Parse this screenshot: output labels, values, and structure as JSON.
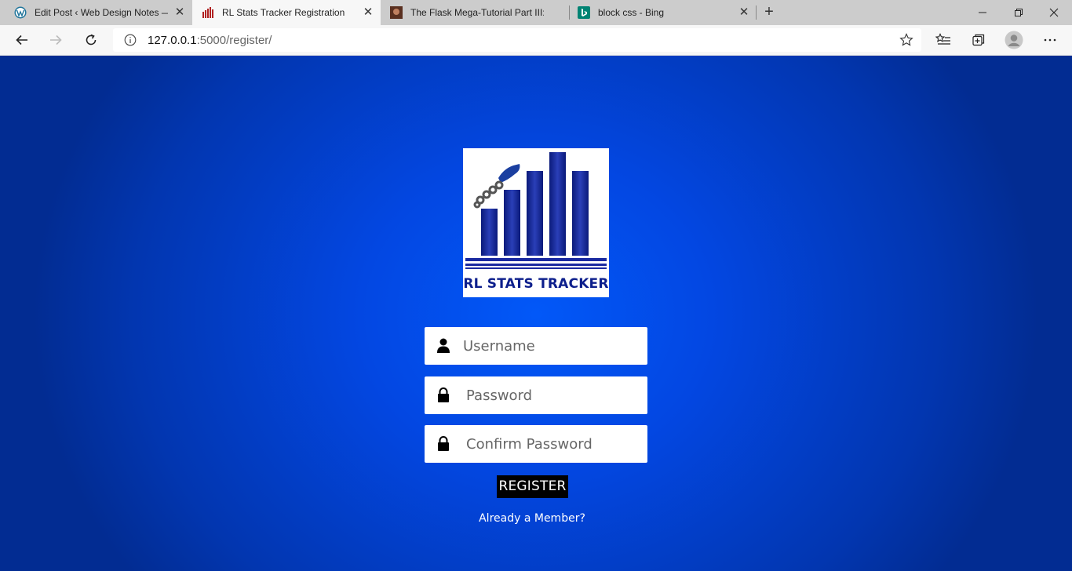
{
  "browser": {
    "tabs": [
      {
        "title": "Edit Post ‹ Web Design Notes —",
        "favicon": "wordpress-icon"
      },
      {
        "title": "RL Stats Tracker Registration",
        "favicon": "rl-stats-icon",
        "active": true
      },
      {
        "title": "The Flask Mega-Tutorial Part III: W",
        "favicon": "flask-author-icon"
      },
      {
        "title": "block css - Bing",
        "favicon": "bing-icon"
      }
    ],
    "new_tab_label": "+",
    "address": {
      "host": "127.0.0.1",
      "path": ":5000/register/"
    }
  },
  "page": {
    "logo": {
      "text": "RL STATS TRACKER",
      "icon": "bar-chart-icon"
    },
    "form": {
      "username_placeholder": "Username",
      "password_placeholder": "Password",
      "confirm_placeholder": "Confirm Password",
      "register_label": "REGISTER",
      "member_link": "Already a Member?"
    }
  },
  "colors": {
    "background": "#0347e2",
    "logo_blue": "#0d1f8c",
    "button": "#000000"
  }
}
